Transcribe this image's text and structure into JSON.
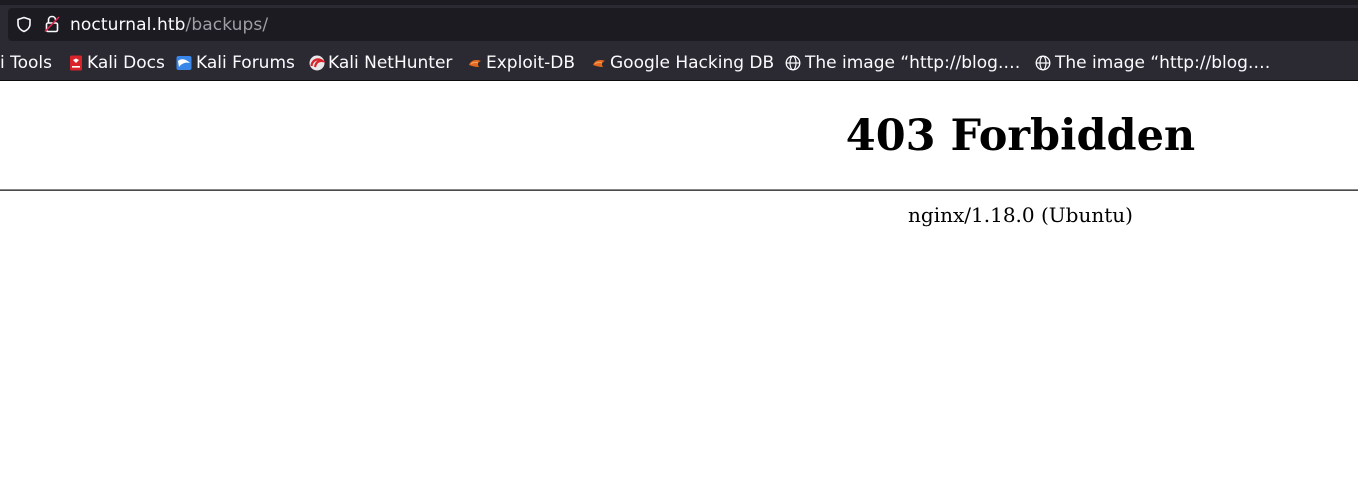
{
  "browser": {
    "address_bar": {
      "host": "nocturnal.htb",
      "path": "/backups/"
    },
    "bookmarks": [
      {
        "label": "i Tools",
        "icon": "none"
      },
      {
        "label": "Kali Docs",
        "icon": "kali-docs-icon"
      },
      {
        "label": "Kali Forums",
        "icon": "kali-forums-icon"
      },
      {
        "label": "Kali NetHunter",
        "icon": "kali-nethunter-icon"
      },
      {
        "label": "Exploit-DB",
        "icon": "exploit-db-icon"
      },
      {
        "label": "Google Hacking DB",
        "icon": "exploit-db-icon"
      },
      {
        "label": "The image “http://blog.…",
        "icon": "globe-icon"
      },
      {
        "label": "The image “http://blog.…",
        "icon": "globe-icon"
      }
    ],
    "colors": {
      "toolbar_bg": "#2b2a33",
      "urlbar_bg": "#1c1b22",
      "text": "#fbfbfe",
      "url_path": "#9e9ea6"
    }
  },
  "page": {
    "heading": "403 Forbidden",
    "server": "nginx/1.18.0 (Ubuntu)"
  }
}
